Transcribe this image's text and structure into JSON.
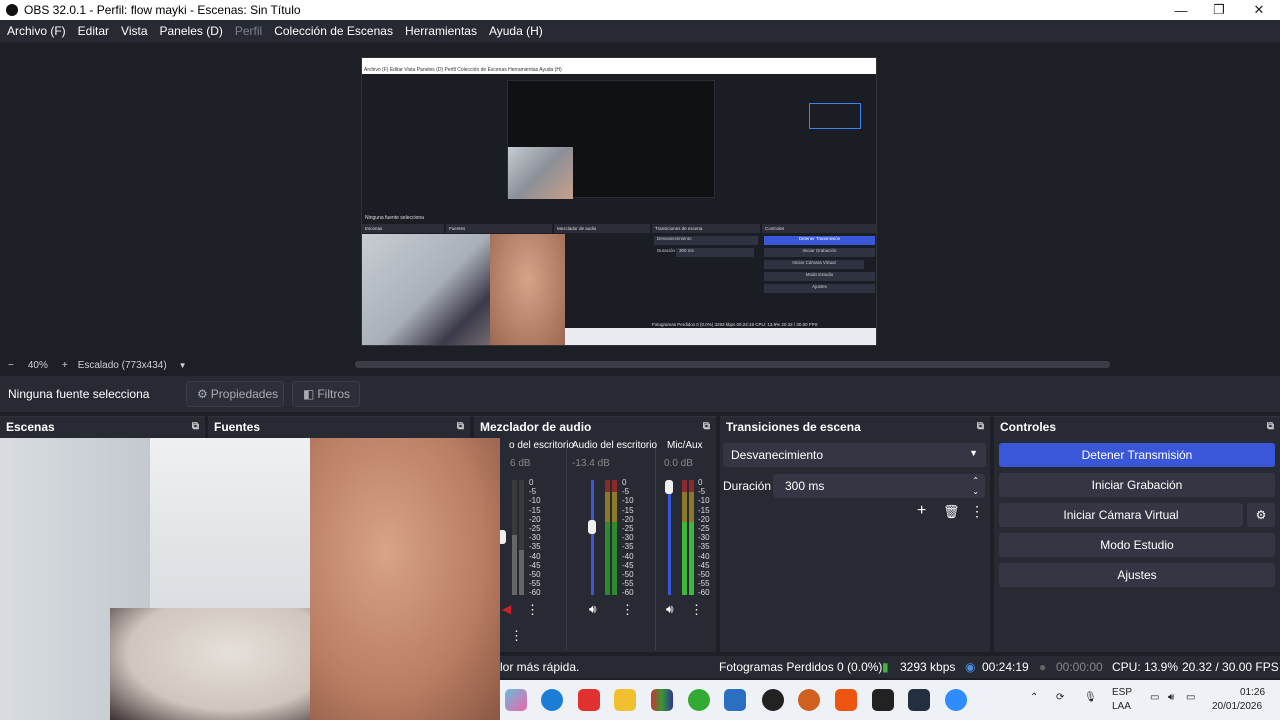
{
  "window": {
    "title": "OBS 32.0.1 - Perfil: flow mayki - Escenas: Sin Título",
    "minimize": "—",
    "maximize": "❐",
    "close": "✕"
  },
  "menu": {
    "items": [
      "Archivo (F)",
      "Editar",
      "Vista",
      "Paneles (D)",
      "Perfil",
      "Colección de Escenas",
      "Herramientas",
      "Ayuda (H)"
    ]
  },
  "zoom": {
    "minus": "−",
    "level": "40%",
    "plus": "+",
    "scale": "Escalado (773x434)",
    "dropdown": "▼"
  },
  "context": {
    "no_source": "Ninguna fuente selecciona",
    "properties": "Propiedades",
    "filters": "Filtros"
  },
  "docks": {
    "scenes": "Escenas",
    "sources": "Fuentes",
    "mixer": "Mezclador de audio",
    "transitions": "Transiciones de escena",
    "controls": "Controles"
  },
  "mixer": {
    "channels": [
      {
        "name": "o del escritorio",
        "db": "6 dB"
      },
      {
        "name": "Audio del escritorio",
        "db": "-13.4 dB"
      },
      {
        "name": "Mic/Aux",
        "db": "0.0 dB"
      }
    ],
    "scale": [
      "0",
      "-5",
      "-10",
      "-15",
      "-20",
      "-25",
      "-30",
      "-35",
      "-40",
      "-45",
      "-50",
      "-55",
      "-60"
    ]
  },
  "transitions": {
    "selected": "Desvanecimiento",
    "duration_label": "Duración",
    "duration_value": "300 ms"
  },
  "controls": {
    "stop_stream": "Detener Transmisión",
    "start_recording": "Iniciar Grabación",
    "start_virtual_cam": "Iniciar Cámara Virtual",
    "studio_mode": "Modo Estudio",
    "settings": "Ajustes"
  },
  "status": {
    "hint": "lor más rápida.",
    "dropped_frames": "Fotogramas Perdidos 0 (0.0%)",
    "bitrate": "3293 kbps",
    "stream_time": "00:24:19",
    "rec_time": "00:00:00",
    "cpu": "CPU: 13.9%",
    "fps": "20.32 / 30.00 FPS"
  },
  "taskbar": {
    "lang1": "ESP",
    "lang2": "LAA",
    "time": "01:26",
    "date": "20/01/2026"
  },
  "preview_thumb": {
    "menu": "Archivo (F)   Editar   Vista   Paneles (D)   Perfil   Colección de Escenas   Herramientas   Ayuda (H)",
    "no_source": "Ninguna fuente selecciona",
    "scenes": "Escenas",
    "sources": "Fuentes",
    "mixer": "Mezclador de audio",
    "transitions": "Transiciones de escena",
    "controls": "Controles",
    "fade": "Desvanecimiento",
    "duration": "Duración",
    "duration_value": "300 ms",
    "stop": "Detener Transmisión",
    "record": "Iniciar Grabación",
    "vcam": "Iniciar Cámara Virtual",
    "studio": "Modo Estudio",
    "settings": "Ajustes",
    "status": "Fotogramas Perdidos 0 (0.0%)   3293 kbps   00:24:19   CPU: 13.9%   20.32 / 30.00 FPS"
  }
}
